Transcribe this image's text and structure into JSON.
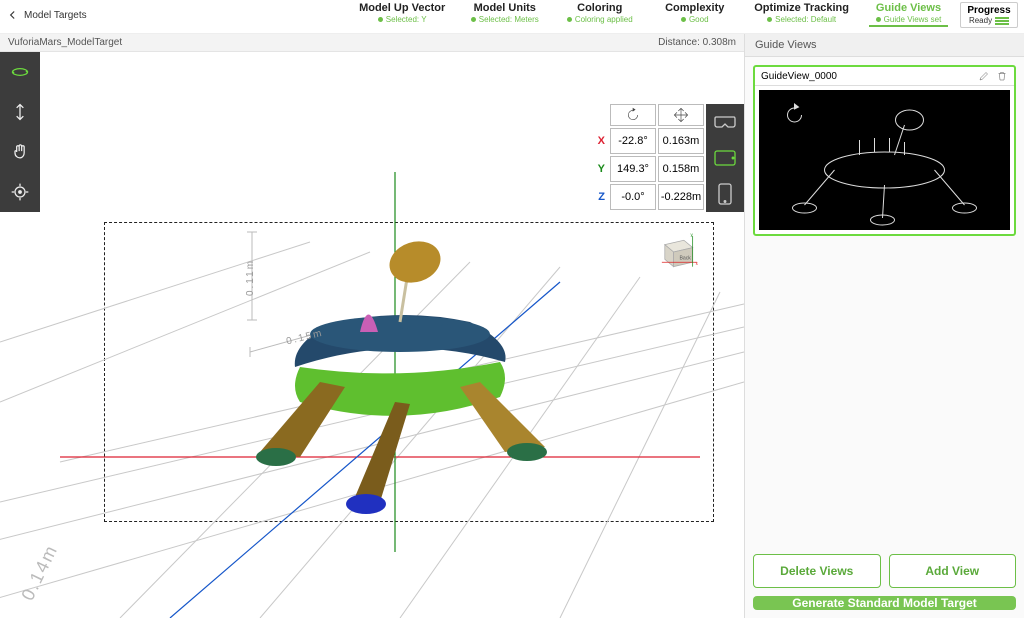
{
  "header": {
    "back_label": "Model Targets",
    "progress_title": "Progress",
    "progress_status": "Ready",
    "steps": [
      {
        "title": "Model Up Vector",
        "sub": "Selected: Y"
      },
      {
        "title": "Model Units",
        "sub": "Selected: Meters"
      },
      {
        "title": "Coloring",
        "sub": "Coloring applied"
      },
      {
        "title": "Complexity",
        "sub": "Good"
      },
      {
        "title": "Optimize Tracking",
        "sub": "Selected: Default"
      },
      {
        "title": "Guide Views",
        "sub": "Guide Views set",
        "active": true
      }
    ]
  },
  "model": {
    "name": "VuforiaMars_ModelTarget",
    "distance_label": "Distance:",
    "distance_value": "0.308m"
  },
  "transform": {
    "x_rot": "-22.8°",
    "x_pos": "0.163m",
    "y_rot": "149.3°",
    "y_pos": "0.158m",
    "z_rot": "-0.0°",
    "z_pos": "-0.228m"
  },
  "dims": {
    "a": "0.15m",
    "b": "0.11m",
    "vert": "0.14m"
  },
  "viewcube_face": "Back",
  "tools": {
    "orbit": "orbit",
    "pan_vert": "pan-vertical",
    "pan_hand": "pan",
    "target": "center"
  },
  "devices": {
    "headset": "headset",
    "tablet": "tablet",
    "phone": "phone"
  },
  "right_panel": {
    "title": "Guide Views",
    "guide_name": "GuideView_0000",
    "btn_delete": "Delete Views",
    "btn_add": "Add View",
    "btn_generate": "Generate Standard Model Target"
  }
}
